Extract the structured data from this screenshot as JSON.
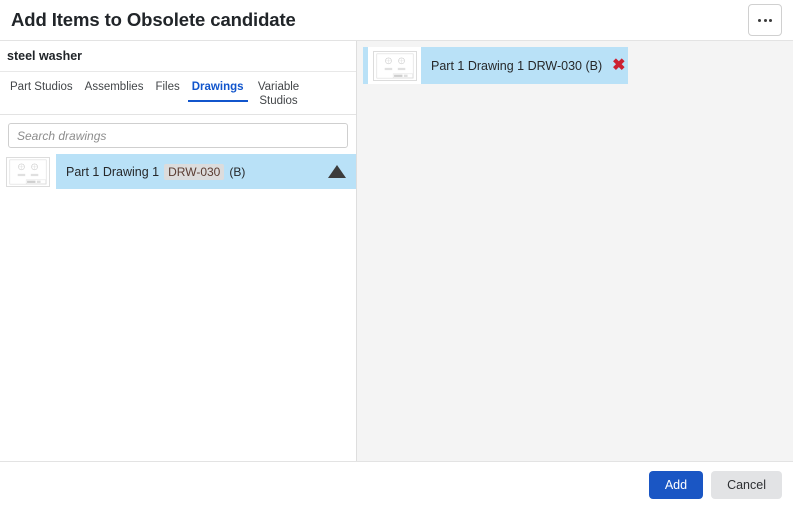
{
  "dialog": {
    "title": "Add Items to Obsolete candidate",
    "menu_button": "···"
  },
  "left_pane": {
    "document_name": "steel washer",
    "tabs": [
      {
        "label": "Part Studios",
        "active": false
      },
      {
        "label": "Assemblies",
        "active": false
      },
      {
        "label": "Files",
        "active": false
      },
      {
        "label": "Drawings",
        "active": true
      },
      {
        "label": "Variable Studios",
        "active": false
      }
    ],
    "search": {
      "placeholder": "Search drawings",
      "value": ""
    },
    "results": [
      {
        "name": "Part 1 Drawing 1",
        "part_number": "DRW-030",
        "revision": "(B)",
        "selected": true,
        "expanded": true
      }
    ]
  },
  "right_pane": {
    "selected_items": [
      {
        "label": "Part 1 Drawing 1 DRW-030 (B)",
        "remove": "✖"
      }
    ]
  },
  "footer": {
    "add_label": "Add",
    "cancel_label": "Cancel"
  },
  "colors": {
    "accent_blue": "#1155cc",
    "primary_button": "#1a56c4",
    "selection_blue": "#b9e1f7",
    "remove_red": "#cc2030",
    "badge_bg": "#dcdcdc"
  }
}
